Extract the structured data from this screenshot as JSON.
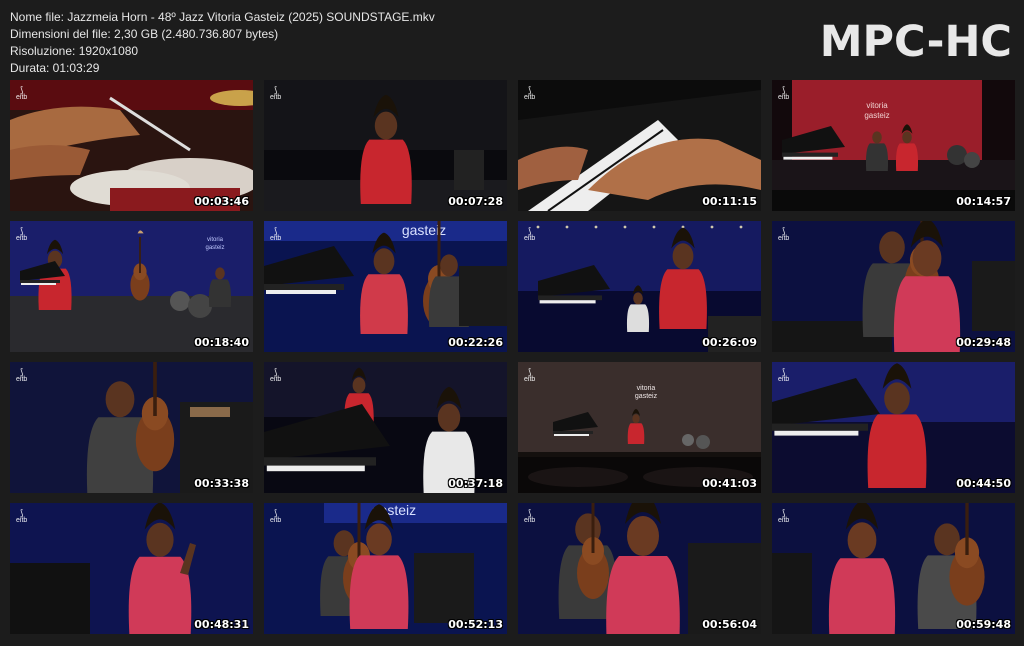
{
  "file_info": {
    "name_line": "Nome file: Jazzmeia Horn - 48º Jazz Vitoria Gasteiz (2025) SOUNDSTAGE.mkv",
    "size_line": "Dimensioni del file: 2,30 GB (2.480.736.807 bytes)",
    "resolution_line": "Risoluzione: 1920x1080",
    "duration_line": "Durata: 01:03:29"
  },
  "app_logo": "MPC-HC",
  "channel_logo": {
    "mark": "⟆",
    "text": "eitb"
  },
  "thumbnails": [
    {
      "time": "00:03:46",
      "scene": "drums-closeup",
      "show_channel_logo": true
    },
    {
      "time": "00:07:28",
      "scene": "singer-red-dark-stage",
      "show_channel_logo": true
    },
    {
      "time": "00:11:15",
      "scene": "piano-hands",
      "show_channel_logo": true
    },
    {
      "time": "00:14:57",
      "scene": "wide-stage-red-backdrop",
      "show_channel_logo": true,
      "backdrop_text": "vitoria gasteiz"
    },
    {
      "time": "00:18:40",
      "scene": "wide-stage-blue",
      "show_channel_logo": true,
      "backdrop_text": "vitoria gasteiz"
    },
    {
      "time": "00:22:26",
      "scene": "singer-bassist-gasteiz",
      "show_channel_logo": true,
      "backdrop_text": "gasteiz"
    },
    {
      "time": "00:26:09",
      "scene": "singer-pianist-blue",
      "show_channel_logo": true
    },
    {
      "time": "00:29:48",
      "scene": "bassist-singer-closeup",
      "show_channel_logo": true
    },
    {
      "time": "00:33:38",
      "scene": "bassist-closeup",
      "show_channel_logo": true
    },
    {
      "time": "00:37:18",
      "scene": "pianist-singer",
      "show_channel_logo": true
    },
    {
      "time": "00:41:03",
      "scene": "wide-stage-audience",
      "show_channel_logo": true,
      "backdrop_text": "vitoria gasteiz"
    },
    {
      "time": "00:44:50",
      "scene": "singer-piano-subtitle",
      "show_channel_logo": true
    },
    {
      "time": "00:48:31",
      "scene": "singer-gesture",
      "show_channel_logo": true
    },
    {
      "time": "00:52:13",
      "scene": "singer-bassist-gasteiz-2",
      "show_channel_logo": true,
      "backdrop_text": "gasteiz"
    },
    {
      "time": "00:56:04",
      "scene": "singer-closeup",
      "show_channel_logo": true
    },
    {
      "time": "00:59:48",
      "scene": "singer-bassist-final",
      "show_channel_logo": true
    }
  ],
  "colors": {
    "background": "#1c1c1c",
    "stage_blue": "#14207a",
    "dress_red": "#c8262e",
    "stage_red": "#9a1e2a"
  }
}
